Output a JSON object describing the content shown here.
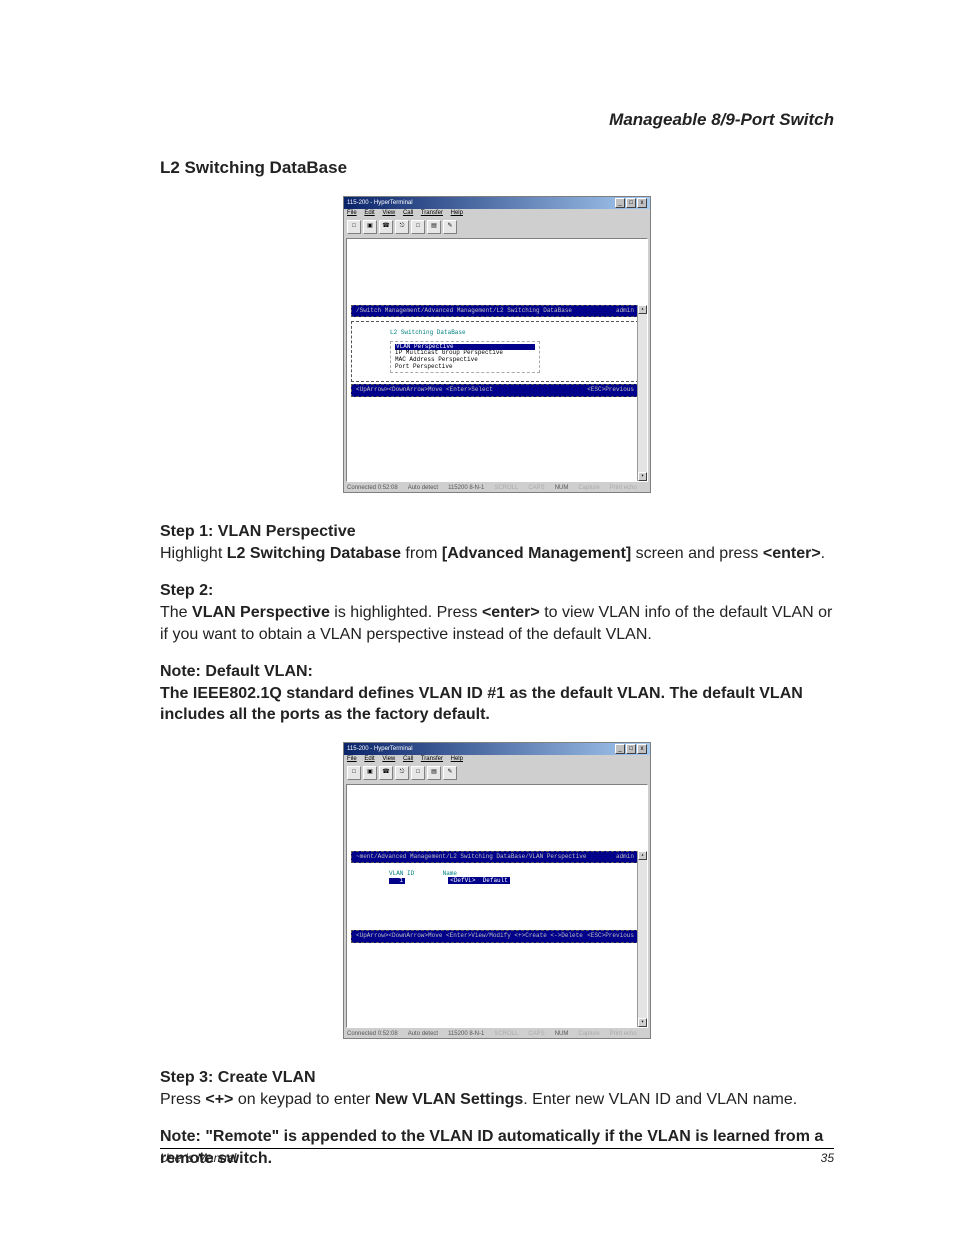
{
  "running_head": "Manageable 8/9-Port Switch",
  "section_title": "L2 Switching DataBase",
  "fig1": {
    "title": "115-200 - HyperTerminal",
    "menubar": [
      "File",
      "Edit",
      "View",
      "Call",
      "Transfer",
      "Help"
    ],
    "breadcrumb": "/Switch Management/Advanced Management/L2 Switching DataBase",
    "user": "admin",
    "panel_title": "L2 Switching DataBase",
    "menu_items": [
      "VLAN Perspective",
      "IP Multicast Group Perspective",
      "MAC Address Perspective",
      "Port Perspective"
    ],
    "foot_left": "<UpArrow><DownArrow>Move  <Enter>Select",
    "foot_right": "<ESC>Previous",
    "status": [
      "Connected 0:52:08",
      "Auto detect",
      "115200 8-N-1",
      "SCROLL",
      "CAPS",
      "NUM",
      "Capture",
      "Print echo"
    ]
  },
  "step1": {
    "heading": "Step 1: VLAN Perspective",
    "pre": "Highlight ",
    "bold1": "L2 Switching Database",
    "mid1": " from ",
    "bold2": "[Advanced Management]",
    "mid2": " screen and press ",
    "bold3": "<enter>",
    "end": "."
  },
  "step2": {
    "heading": "Step 2:",
    "pre": "The ",
    "bold1": "VLAN Perspective",
    "mid1": " is highlighted. Press ",
    "bold2": "<enter>",
    "rest": " to view VLAN info of the default VLAN or if you want to obtain a VLAN perspective instead of the default VLAN."
  },
  "note1": {
    "heading": "Note:   Default VLAN:",
    "body": "The IEEE802.1Q standard defines VLAN ID #1 as the default VLAN. The default VLAN includes all the ports as the factory default."
  },
  "fig2": {
    "title": "115-200 - HyperTerminal",
    "menubar": [
      "File",
      "Edit",
      "View",
      "Call",
      "Transfer",
      "Help"
    ],
    "breadcrumb": "~ment/Advanced Management/L2 Switching DataBase/VLAN Perspective",
    "user": "admin",
    "col1": "VLAN ID",
    "col2": "Name",
    "row_id": "1",
    "row_tag": "<DefVL>",
    "row_name": "Default",
    "foot_left": "<UpArrow><DownArrow>Move <Enter>View/Modify <+>Create <->Delete",
    "foot_right": "<ESC>Previous",
    "status": [
      "Connected 0:52:08",
      "Auto detect",
      "115200 8-N-1",
      "SCROLL",
      "CAPS",
      "NUM",
      "Capture",
      "Print echo"
    ]
  },
  "step3": {
    "heading": "Step 3: Create VLAN",
    "pre": "Press  ",
    "bold1": "<+>",
    "mid1": "  on keypad to enter ",
    "bold2": "New VLAN Settings",
    "rest": ". Enter new VLAN ID and VLAN name."
  },
  "note2": {
    "text": "Note:   \"Remote\" is appended to the VLAN ID automatically if the VLAN is learned from a remote switch."
  },
  "footer_left": "User's Manual",
  "footer_right": "35"
}
